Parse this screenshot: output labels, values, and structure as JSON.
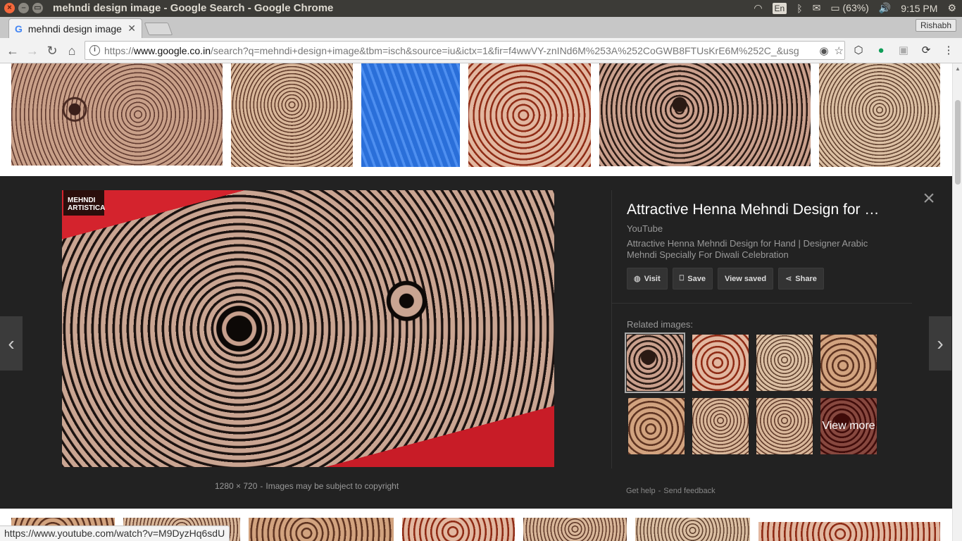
{
  "os": {
    "window_title": "mehndi design image - Google Search - Google Chrome",
    "lang": "En",
    "battery": "(63%)",
    "clock": "9:15 PM"
  },
  "browser": {
    "tab_title": "mehndi design image",
    "profile": "Rishabh",
    "url_scheme": "https://",
    "url_host": "www.google.co.in",
    "url_path": "/search?q=mehndi+design+image&tbm=isch&source=iu&ictx=1&fir=f4wwVY-znINd6M%253A%252CoGWB8FTUsKrE6M%252C_&usg",
    "status_url": "https://www.youtube.com/watch?v=M9DyzHq6sdU"
  },
  "preview": {
    "badge_line1": "MEHNDI",
    "badge_line2": "ARTISTICA",
    "title": "Attractive Henna Mehndi Design for …",
    "source": "YouTube",
    "description": "Attractive Henna Mehndi Design for Hand | Designer Arabic Mehndi Specially For Diwali Celebration",
    "actions": {
      "visit": "Visit",
      "save": "Save",
      "view_saved": "View saved",
      "share": "Share"
    },
    "related_label": "Related images:",
    "view_more": "View more",
    "dimensions": "1280 × 720",
    "dim_separator": "-",
    "copyright": "Images may be subject to copyright",
    "get_help": "Get help",
    "foot_separator": "-",
    "send_feedback": "Send feedback"
  },
  "colors": {
    "panel_bg": "#222222",
    "chrome_toolbar": "#f2f2f2",
    "os_bar": "#3c3b37"
  }
}
